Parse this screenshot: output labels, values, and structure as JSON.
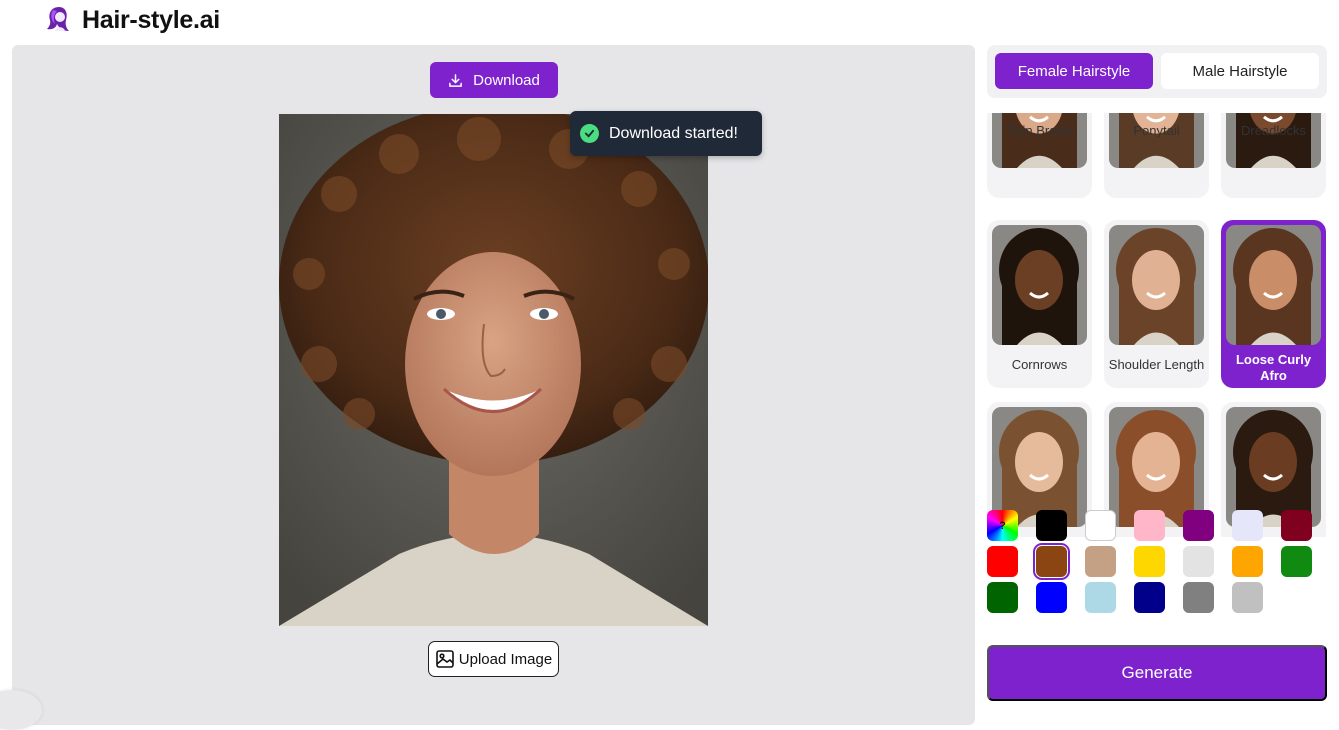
{
  "app": {
    "title": "Hair-style.ai",
    "brand_color": "#7e22ce"
  },
  "editor": {
    "download_label": "Download",
    "upload_label": "Upload Image",
    "toast_text": "Download started!"
  },
  "tabs": {
    "female": "Female Hairstyle",
    "male": "Male Hairstyle",
    "active": "female"
  },
  "styles": [
    {
      "label": "Twin Braids",
      "hair": "#4a2c1a",
      "skin": "#d9a98a"
    },
    {
      "label": "Ponytail",
      "hair": "#5a3b25",
      "skin": "#e2b394"
    },
    {
      "label": "Dreadlocks",
      "hair": "#2b1a10",
      "skin": "#7a4a2e"
    },
    {
      "label": "Cornrows",
      "hair": "#1f140c",
      "skin": "#6b3f24"
    },
    {
      "label": "Shoulder Length",
      "hair": "#6a4329",
      "skin": "#e0b192"
    },
    {
      "label": "Loose Curly Afro",
      "hair": "#5a3520",
      "skin": "#c98d68"
    },
    {
      "label": "",
      "hair": "#7a5232",
      "skin": "#e6bb9c"
    },
    {
      "label": "",
      "hair": "#8a4f2a",
      "skin": "#e4b393"
    },
    {
      "label": "",
      "hair": "#2a1a10",
      "skin": "#6a3d22"
    }
  ],
  "selected_style": "Loose Curly Afro",
  "colors": [
    {
      "name": "random",
      "hex": "rainbow",
      "mark": "?"
    },
    {
      "name": "black",
      "hex": "#000000"
    },
    {
      "name": "white",
      "hex": "#ffffff"
    },
    {
      "name": "pink",
      "hex": "#ffb6c8"
    },
    {
      "name": "purple",
      "hex": "#800080"
    },
    {
      "name": "lavender",
      "hex": "#e6e6fa"
    },
    {
      "name": "burgundy",
      "hex": "#800020"
    },
    {
      "name": "red",
      "hex": "#ff0000"
    },
    {
      "name": "brown",
      "hex": "#8b4513"
    },
    {
      "name": "tan",
      "hex": "#c4a084"
    },
    {
      "name": "gold",
      "hex": "#ffd700"
    },
    {
      "name": "light-gray",
      "hex": "#e3e3e3"
    },
    {
      "name": "orange",
      "hex": "#ffa500"
    },
    {
      "name": "green",
      "hex": "#108a10"
    },
    {
      "name": "dark-green",
      "hex": "#006400"
    },
    {
      "name": "blue",
      "hex": "#0000ff"
    },
    {
      "name": "light-blue",
      "hex": "#add8e6"
    },
    {
      "name": "navy",
      "hex": "#00008b"
    },
    {
      "name": "gray",
      "hex": "#808080"
    },
    {
      "name": "silver",
      "hex": "#c0c0c0"
    }
  ],
  "selected_color": "brown",
  "generate_label": "Generate"
}
